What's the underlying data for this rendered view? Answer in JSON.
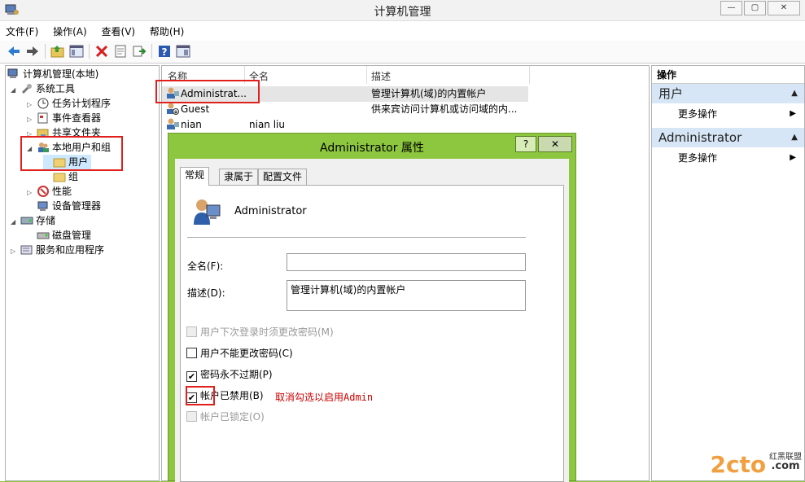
{
  "window": {
    "title": "计算机管理",
    "btn_min": "—",
    "btn_max": "▢",
    "btn_close": "✕"
  },
  "menu": [
    "文件(F)",
    "操作(A)",
    "查看(V)",
    "帮助(H)"
  ],
  "toolbar_icons": [
    "back-icon",
    "forward-icon",
    "up-folder-icon",
    "properties-icon",
    "delete-icon",
    "export-icon",
    "refresh-icon",
    "help-icon",
    "console-icon"
  ],
  "tree": {
    "root": "计算机管理(本地)",
    "system_tools": "系统工具",
    "task_scheduler": "任务计划程序",
    "event_viewer": "事件查看器",
    "shared_folders": "共享文件夹",
    "local_users_groups": "本地用户和组",
    "users": "用户",
    "groups": "组",
    "performance": "性能",
    "device_manager": "设备管理器",
    "storage": "存储",
    "disk_management": "磁盘管理",
    "services_apps": "服务和应用程序"
  },
  "list": {
    "columns": [
      "名称",
      "全名",
      "描述"
    ],
    "rows": [
      {
        "name": "Administrat...",
        "fullname": "",
        "desc": "管理计算机(域)的内置帐户"
      },
      {
        "name": "Guest",
        "fullname": "",
        "desc": "供来宾访问计算机或访问域的内..."
      },
      {
        "name": "nian",
        "fullname": "nian liu",
        "desc": ""
      }
    ]
  },
  "actions": {
    "header": "操作",
    "section1": "用户",
    "section1_more": "更多操作",
    "section2": "Administrator",
    "section2_more": "更多操作"
  },
  "dialog": {
    "title": "Administrator 属性",
    "help_btn": "?",
    "close_btn": "✕",
    "tabs": [
      "常规",
      "隶属于",
      "配置文件"
    ],
    "username": "Administrator",
    "fullname_label": "全名(F):",
    "fullname_value": "",
    "desc_label": "描述(D):",
    "desc_value": "管理计算机(域)的内置帐户",
    "cb_must_change": "用户下次登录时须更改密码(M)",
    "cb_cannot_change": "用户不能更改密码(C)",
    "cb_never_expires": "密码永不过期(P)",
    "cb_disabled": "帐户已禁用(B)",
    "cb_locked": "帐户已锁定(O)",
    "check_mark": "✔",
    "annotation": "取消勾选以启用Admin"
  },
  "watermark": {
    "logo": "2cto",
    "sub1": "红黑联盟",
    "sub2": ".com"
  }
}
